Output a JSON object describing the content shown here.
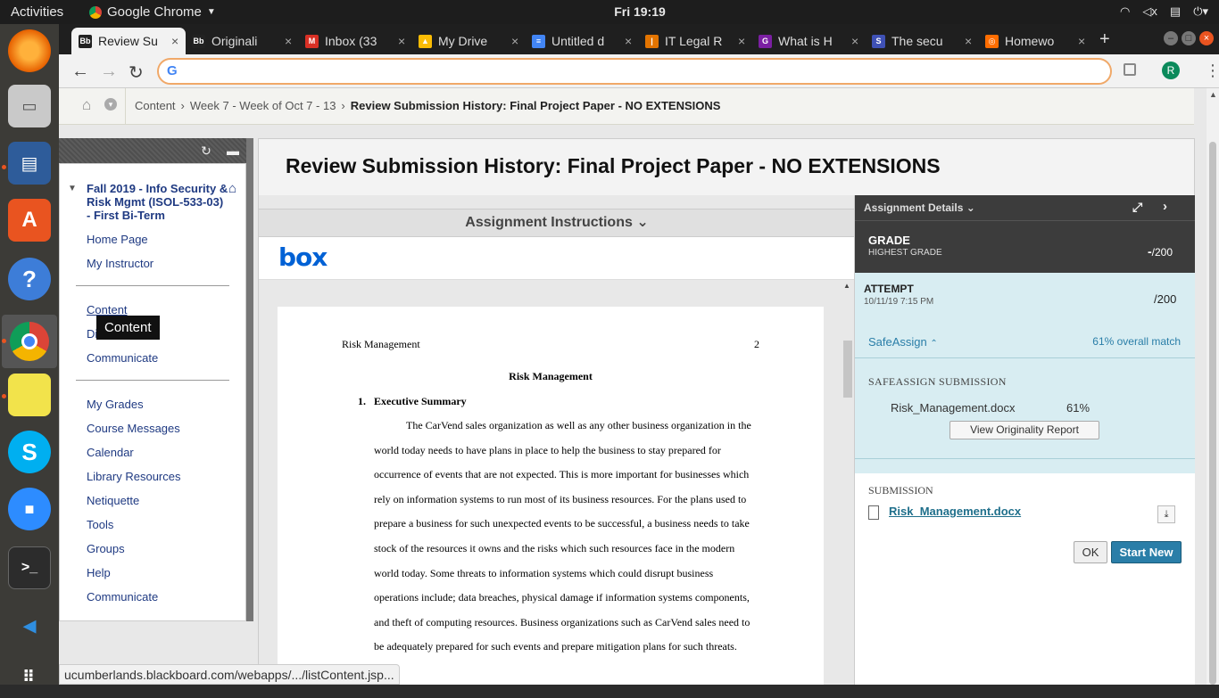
{
  "topbar": {
    "activities": "Activities",
    "app": "Google Chrome",
    "clock": "Fri 19:19"
  },
  "dock": {
    "items": [
      "firefox-icon",
      "files-icon",
      "writer-icon",
      "software-icon",
      "help-icon",
      "chrome-icon",
      "notes-icon",
      "skype-icon",
      "zoom-icon",
      "terminal-icon",
      "vscode-icon",
      "apps-grid-icon"
    ]
  },
  "browser": {
    "tabs": [
      {
        "title": "Review Su",
        "icon": "Bb",
        "color": "#222"
      },
      {
        "title": "Originali",
        "icon": "Bb",
        "color": "#222"
      },
      {
        "title": "Inbox (33",
        "icon": "M",
        "color": "#d93025"
      },
      {
        "title": "My Drive",
        "icon": "▲",
        "color": "#fbbc04"
      },
      {
        "title": "Untitled d",
        "icon": "≡",
        "color": "#4285f4"
      },
      {
        "title": "IT Legal R",
        "icon": "|",
        "color": "#e37400"
      },
      {
        "title": "What is H",
        "icon": "G",
        "color": "#7b1fa2"
      },
      {
        "title": "The secu",
        "icon": "S",
        "color": "#3f51b5"
      },
      {
        "title": "Homewo",
        "icon": "◎",
        "color": "#ff6d00"
      }
    ],
    "omnibox": {
      "value": "",
      "placeholder": ""
    },
    "profile_initial": "R",
    "status_url": "ucumberlands.blackboard.com/webapps/.../listContent.jsp..."
  },
  "breadcrumb": {
    "items": [
      "Content",
      "Week 7 - Week of Oct 7 - 13"
    ],
    "current": "Review Submission History: Final Project Paper - NO EXTENSIONS",
    "separator": "›"
  },
  "course_menu": {
    "course_title": "Fall 2019 - Info Security & Risk Mgmt (ISOL-533-03) - First Bi-Term",
    "group1": [
      "Home Page",
      "My Instructor"
    ],
    "group2": [
      "Content",
      "Discussions",
      "Communicate"
    ],
    "group3": [
      "My Grades",
      "Course Messages",
      "Calendar",
      "Library Resources",
      "Netiquette",
      "Tools",
      "Groups",
      "Help",
      "Communicate"
    ],
    "tooltip": "Content",
    "group2_visible": [
      "Content",
      "Di",
      "Communicate"
    ]
  },
  "main": {
    "title": "Review Submission History: Final Project Paper - NO EXTENSIONS",
    "instructions_label": "Assignment Instructions",
    "box_logo": "box",
    "document": {
      "header": "Risk Management",
      "page_number": "2",
      "title": "Risk Management",
      "section_number": "1.",
      "section_title": "Executive Summary",
      "body_lines": [
        "The CarVend sales organization as well as any other business organization in the",
        "world today needs to have plans in place to help the business to stay prepared for",
        "occurrence of events that are not expected. This is more important for businesses which",
        "rely on information systems to run most of its business resources. For the plans used to",
        "prepare a business for such unexpected events to be successful, a business needs to take",
        "stock of the resources it owns and the risks which such resources face in the modern",
        "world today. Some threats to information systems which could disrupt business",
        "operations include; data breaches, physical damage if information systems components,",
        "and theft of computing resources. Business organizations such as CarVend sales need to",
        "be adequately prepared for such events and prepare mitigation plans for such threats."
      ]
    }
  },
  "details": {
    "header": "Assignment Details",
    "grade_label": "GRADE",
    "grade_sub": "HIGHEST GRADE",
    "grade_value": "-",
    "grade_total": "/200",
    "attempt_label": "ATTEMPT",
    "attempt_date": "10/11/19 7:15 PM",
    "attempt_total": "/200",
    "safeassign_label": "SafeAssign",
    "overall_match": "61% overall match",
    "sa_submission_label": "SAFEASSIGN SUBMISSION",
    "sa_file": "Risk_Management.docx",
    "sa_percent": "61%",
    "view_report": "View Originality Report",
    "submission_label": "SUBMISSION",
    "submission_file": "Risk_Management.docx",
    "ok": "OK",
    "start_new": "Start New"
  }
}
